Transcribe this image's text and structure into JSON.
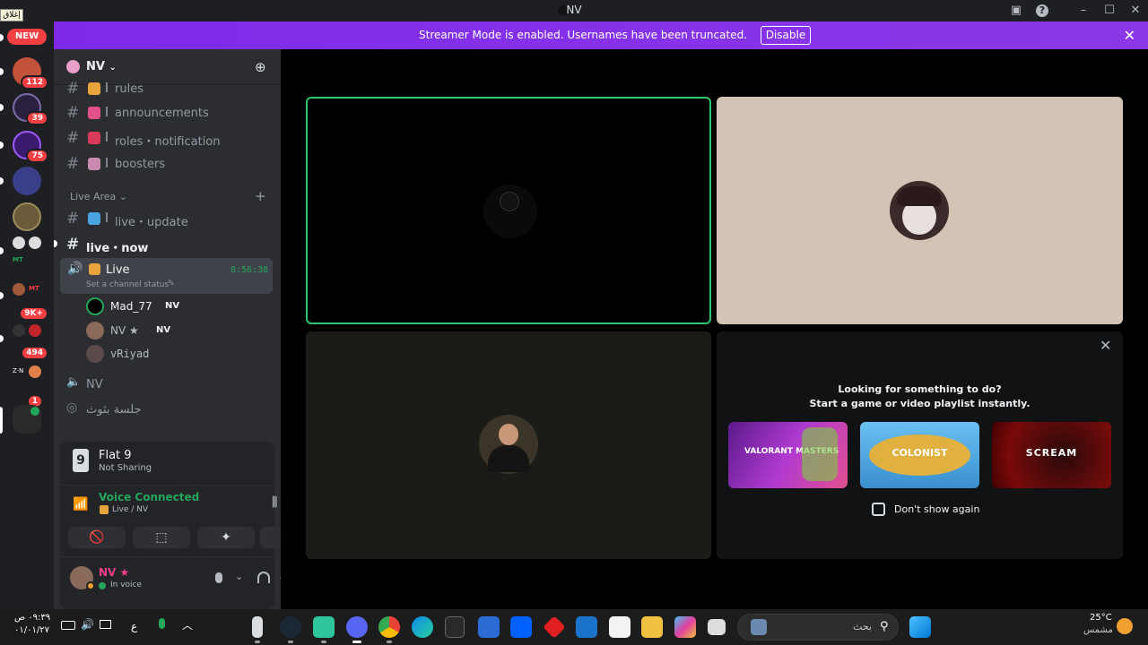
{
  "window": {
    "title": "NV",
    "overlay_label": "إغلاق"
  },
  "rail": {
    "new_badge": "NEW",
    "badges": [
      "112",
      "39",
      "75",
      "9K+",
      "494",
      "1"
    ],
    "mini_labels": [
      "MT",
      "MT",
      "Z·N"
    ]
  },
  "banner": {
    "text": "Streamer Mode is enabled. Usernames have been truncated.",
    "disable_label": "Disable",
    "close_icon": "close-icon"
  },
  "guild": {
    "name": "NV"
  },
  "channels": {
    "text": [
      {
        "label": "rules"
      },
      {
        "label": "announcements"
      },
      {
        "label": "roles・notification"
      },
      {
        "label": "boosters"
      }
    ],
    "category": "Live Area",
    "live_text": [
      {
        "label": "live・update"
      },
      {
        "label": "live・now"
      }
    ],
    "voice": {
      "name": "Live",
      "timer": "8:56:38",
      "status_placeholder": "Set a channel status"
    },
    "members": [
      {
        "name": "Mad_77",
        "tag": "NV"
      },
      {
        "name": "NV ★",
        "tag": "NV"
      },
      {
        "name": "vRiyad",
        "tag": ""
      }
    ],
    "other_voice": "NV",
    "stage": "جلسة بثوث"
  },
  "panel": {
    "activity_title": "Flat 9",
    "activity_sub": "Not Sharing",
    "voice_status": "Voice Connected",
    "voice_channel": "Live / NV",
    "user_name": "NV ★",
    "user_status": "In voice"
  },
  "stage": {
    "promo_line1": "Looking for something to do?",
    "promo_line2": "Start a game or video playlist instantly.",
    "games": [
      "VALORANT MASTERS",
      "COLONIST",
      "SCREAM"
    ],
    "dont_show": "Don't show again"
  },
  "taskbar": {
    "time": "٠٩:٣٩ ص",
    "date": "٠١/٠١/٢٧",
    "lang": "ع",
    "search_placeholder": "بحث",
    "weather_temp": "25°C",
    "weather_desc": "مشمس"
  },
  "colors": {
    "banner": "#8033e8",
    "accent_green": "#23a55a",
    "sidebar": "#2b2d31",
    "rail": "#1e1f22"
  }
}
